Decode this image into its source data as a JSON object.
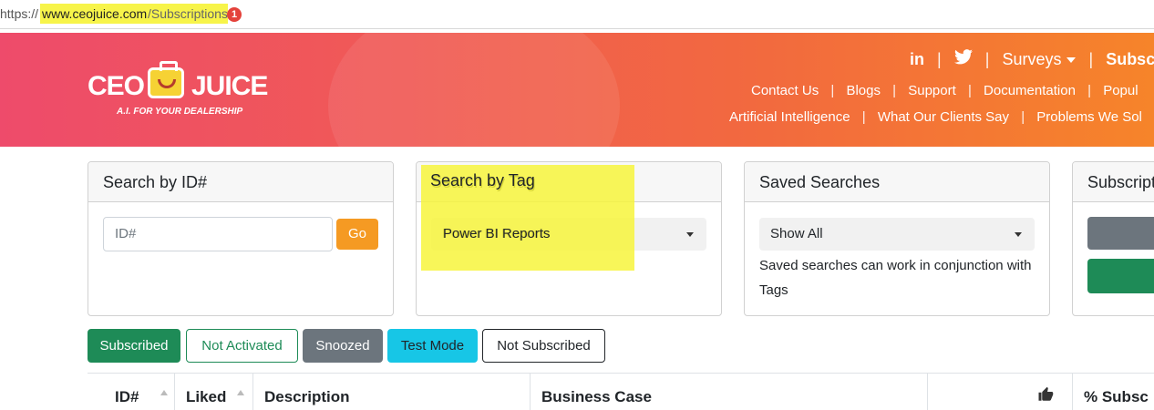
{
  "url": {
    "protocol": "https://",
    "domain": "www.ceojuice.com",
    "path": "/Subscriptions",
    "badge": "1"
  },
  "logo": {
    "left_word": "CEO",
    "right_word": "JUICE",
    "tagline": "A.I. FOR YOUR DEALERSHIP"
  },
  "nav": {
    "top": {
      "linkedin": "in",
      "surveys": "Surveys",
      "subscriptions": "Subscr"
    },
    "row2": [
      "Contact Us",
      "Blogs",
      "Support",
      "Documentation",
      "Popul"
    ],
    "row3": [
      "Artificial Intelligence",
      "What Our Clients Say",
      "Problems We Sol"
    ]
  },
  "cards": {
    "search_id": {
      "title": "Search by ID#",
      "placeholder": "ID#",
      "go": "Go"
    },
    "search_tag": {
      "title": "Search by Tag",
      "selected": "Power BI Reports"
    },
    "saved": {
      "title": "Saved Searches",
      "selected": "Show All",
      "note": "Saved searches can work in conjunction with Tags"
    },
    "subscriptions": {
      "title": "Subscript"
    }
  },
  "filters": [
    "Subscribed",
    "Not Activated",
    "Snoozed",
    "Test Mode",
    "Not Subscribed"
  ],
  "table": {
    "headers": [
      "ID#",
      "Liked",
      "Description",
      "Business Case",
      "",
      "% Subsc"
    ]
  },
  "colors": {
    "accent_orange": "#f59a23",
    "subscribed_green": "#1e8b57",
    "test_mode_cyan": "#17c6e6",
    "snoozed_gray": "#6c757d",
    "highlight_yellow": "#f7f44a"
  }
}
